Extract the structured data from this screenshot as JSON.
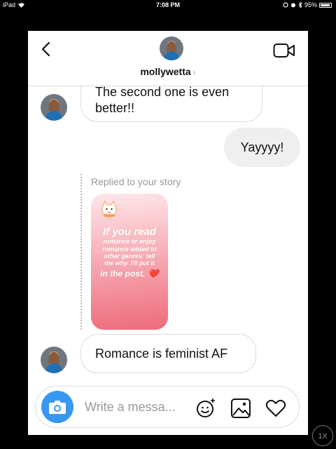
{
  "status_bar": {
    "device": "iPad",
    "time": "7:08 PM",
    "battery": "95%"
  },
  "header": {
    "username": "mollywetta",
    "chevron": "›"
  },
  "messages": [
    {
      "direction": "incoming",
      "text": "The second one is even better!!"
    },
    {
      "direction": "outgoing",
      "text": "Yayyyy!"
    },
    {
      "direction": "incoming",
      "type": "story_reply",
      "label": "Replied to your story",
      "story_text": {
        "line1": "If you read",
        "line2": "romance or enjoy",
        "line3": "romance added to",
        "line4": "other genres: tell",
        "line5": "me why. I'll put it",
        "line6": "in the post.",
        "heart": "❤️"
      }
    },
    {
      "direction": "incoming",
      "text": "Romance is feminist AF"
    }
  ],
  "message_lines": {
    "first_top": "The second one is even",
    "first_bottom": "better!!"
  },
  "composer": {
    "placeholder": "Write a messa..."
  },
  "zoom_button": "1X",
  "colors": {
    "accent": "#3897f0",
    "story_top": "#fde7ea",
    "story_bottom": "#ed6b7a"
  }
}
